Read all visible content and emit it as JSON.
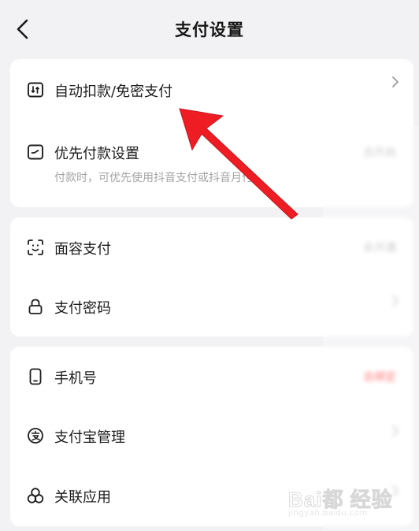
{
  "header": {
    "title": "支付设置",
    "back_icon": "chevron-left-icon"
  },
  "sections": [
    {
      "items": [
        {
          "icon": "auto-debit-icon",
          "label": "自动扣款/免密支付",
          "right": "chevron"
        },
        {
          "icon": "priority-pay-icon",
          "label": "优先付款设置",
          "sub": "付款时，可优先使用抖音支付或抖音月付",
          "right_text": "去开启"
        }
      ]
    },
    {
      "items": [
        {
          "icon": "face-scan-icon",
          "label": "面容支付",
          "right_text": "未开通"
        },
        {
          "icon": "lock-icon",
          "label": "支付密码",
          "right": "chevron"
        }
      ]
    },
    {
      "items": [
        {
          "icon": "phone-icon",
          "label": "手机号",
          "right_text": "去绑定",
          "right_color": "#ff4d4f"
        },
        {
          "icon": "alipay-icon",
          "label": "支付宝管理",
          "right": "chevron"
        },
        {
          "icon": "linked-apps-icon",
          "label": "关联应用",
          "right": "chevron"
        }
      ]
    }
  ],
  "annotation": {
    "arrow_color": "#ee1d24"
  },
  "watermark": {
    "logo": "Bai都 经验",
    "sub": "jingyan.baidu.com"
  }
}
